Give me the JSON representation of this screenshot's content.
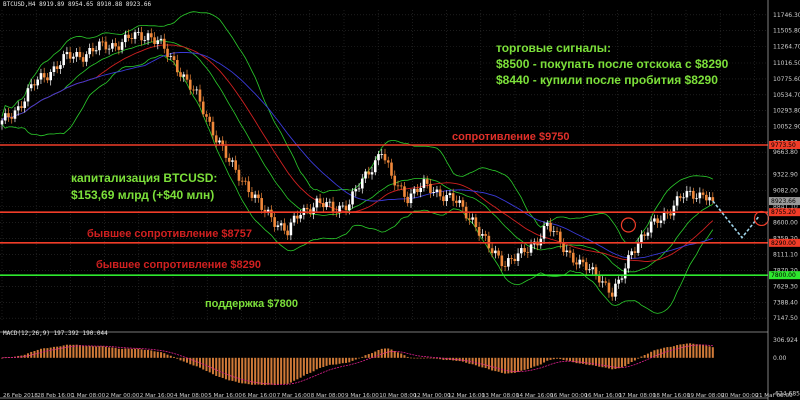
{
  "header": {
    "symbol_info": "BTCUSD,H4  8919.89 8954.65 8910.88 8923.66"
  },
  "macd": {
    "label": "MACD(12,26,9) 197.392 190.044"
  },
  "colors": {
    "background": "#000000",
    "grid": "#2f2f2f",
    "axis": "#a0a0a0",
    "bull": "#ffffff",
    "bear": "#f0883a",
    "level_red": "#f03c28",
    "level_green": "#2ee82e",
    "bb": "#2bcd2b",
    "ma_red": "#d02020",
    "ma_blue": "#3a3ad8",
    "macd_hist": "#d07a38",
    "macd_signal": "#e02090",
    "forecast": "#9fd3e8"
  },
  "annotations": {
    "signals_title": "торговые сигналы:",
    "signal_1": "$8500 - покупать после отскока с $8290",
    "signal_2": "$8440 - купили после пробития $8290",
    "resistance": "сопротивление $9750",
    "cap_title": "капитализация BTCUSD:",
    "cap_value": "$153,69 млрд (+$40 млн)",
    "former_res_1": "бывшее сопротивление $8757",
    "former_res_2": "бывшее сопротивление $8290",
    "support": "поддержка $7800"
  },
  "chart_data": {
    "type": "candlestick",
    "price_axis_labels": [
      "11746.30",
      "11505.80",
      "11264.70",
      "11016.50",
      "10775.60",
      "10534.70",
      "10293.80",
      "10052.90",
      "9812.00",
      "9663.80",
      "9322.90",
      "9082.00",
      "8841.10",
      "8600.00",
      "8359.20",
      "8111.10",
      "7870.20",
      "7629.30",
      "7388.40",
      "7147.50"
    ],
    "price_range": [
      7090,
      11820
    ],
    "macd_axis_labels": [
      "306.924",
      "0.00",
      "-624.685"
    ],
    "macd_range": [
      -700,
      380
    ],
    "price_tags": [
      {
        "value": "9773.50",
        "color": "#f03c28"
      },
      {
        "value": "8923.66",
        "color": "#9a9a9a"
      },
      {
        "value": "8755.20",
        "color": "#f03c28"
      },
      {
        "value": "8290.00",
        "color": "#f03c28"
      },
      {
        "value": "7800.00",
        "color": "#2ee82e"
      }
    ],
    "time_labels": [
      "26 Feb 2018",
      "28 Feb 16:00",
      "1 Mar 08:00",
      "2 Mar 00:00",
      "2 Mar 16:00",
      "4 Mar 08:00",
      "5 Mar 16:00",
      "6 Mar 16:00",
      "7 Mar 16:00",
      "8 Mar 08:00",
      "9 Mar 16:00",
      "10 Mar 08:00",
      "12 Mar 00:00",
      "12 Mar 16:00",
      "13 Mar 08:00",
      "14 Mar 16:00",
      "16 Mar 00:00",
      "16 Mar 16:00",
      "17 Mar 08:00",
      "18 Mar 16:00",
      "19 Mar 08:00",
      "20 Mar 00:00",
      "21 Mar 08:00"
    ],
    "levels": [
      {
        "value": 9773.5,
        "color": "#f03c28"
      },
      {
        "value": 8755.2,
        "color": "#f03c28"
      },
      {
        "value": 8290,
        "color": "#f03c28"
      },
      {
        "value": 7800,
        "color": "#2ee82e"
      }
    ],
    "anchors": [
      [
        0,
        10100
      ],
      [
        5,
        10350
      ],
      [
        10,
        10700
      ],
      [
        15,
        10900
      ],
      [
        20,
        11100
      ],
      [
        25,
        11150
      ],
      [
        30,
        11250
      ],
      [
        35,
        11300
      ],
      [
        40,
        11400
      ],
      [
        45,
        11450
      ],
      [
        48,
        11350
      ],
      [
        50,
        11200
      ],
      [
        55,
        10900
      ],
      [
        60,
        10500
      ],
      [
        65,
        10000
      ],
      [
        70,
        9500
      ],
      [
        75,
        9200
      ],
      [
        80,
        8800
      ],
      [
        85,
        8600
      ],
      [
        88,
        8450
      ],
      [
        92,
        8750
      ],
      [
        97,
        8900
      ],
      [
        102,
        8800
      ],
      [
        107,
        8900
      ],
      [
        112,
        9300
      ],
      [
        117,
        9700
      ],
      [
        120,
        9250
      ],
      [
        125,
        9000
      ],
      [
        130,
        9150
      ],
      [
        135,
        9050
      ],
      [
        140,
        8900
      ],
      [
        145,
        8650
      ],
      [
        150,
        8200
      ],
      [
        155,
        8000
      ],
      [
        160,
        8100
      ],
      [
        165,
        8350
      ],
      [
        168,
        8550
      ],
      [
        172,
        8300
      ],
      [
        178,
        7950
      ],
      [
        184,
        7800
      ],
      [
        188,
        7500
      ],
      [
        190,
        7650
      ],
      [
        194,
        8200
      ],
      [
        198,
        8400
      ],
      [
        202,
        8650
      ],
      [
        206,
        8800
      ],
      [
        210,
        9000
      ],
      [
        214,
        9050
      ],
      [
        217,
        9000
      ],
      [
        219,
        8923.66
      ]
    ],
    "forecast": [
      [
        219,
        8923.66
      ],
      [
        228,
        8370
      ],
      [
        233,
        8680
      ]
    ],
    "circles": [
      {
        "index": 193,
        "value": 8560,
        "color": "#f03c28"
      },
      {
        "index": 234,
        "value": 8660,
        "color": "#f03c28"
      }
    ]
  }
}
